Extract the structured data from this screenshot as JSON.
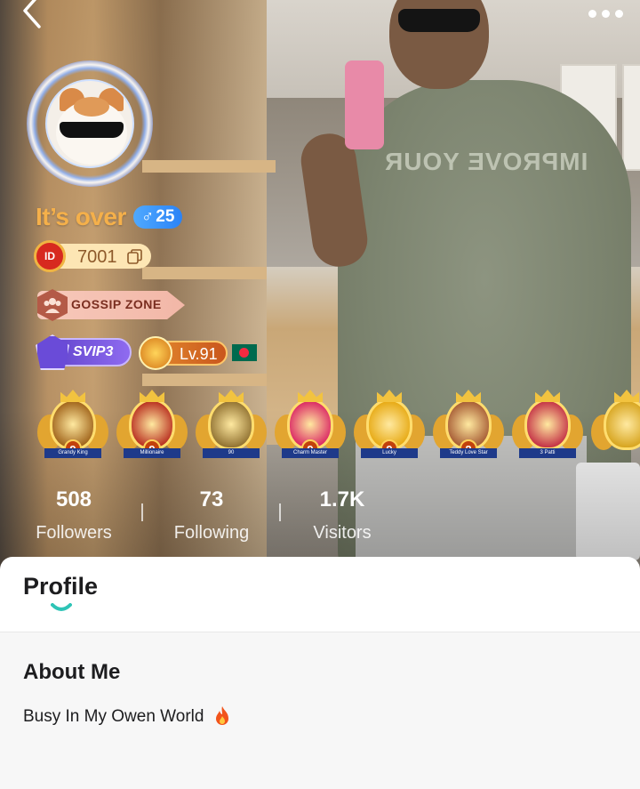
{
  "header": {
    "more_icon": "more-dots-icon",
    "back_icon": "chevron-left-icon"
  },
  "background_photo": {
    "shirt_text": "IMPROVE YOUR"
  },
  "user": {
    "name": "It’s over",
    "gender_symbol": "♂",
    "age": "25",
    "id_badge_text": "ID",
    "id_value": "7001",
    "zone_label": "GOSSIP ZONE",
    "svip_label": "SVIP3",
    "level_label": "Lv.91",
    "country_flag": "bangladesh-flag"
  },
  "colors": {
    "name": "#f5b04a",
    "gender_badge": "#2b83f6",
    "tab_indicator": "#2ec4b6"
  },
  "medals": [
    {
      "name": "Grandy King",
      "number": "9",
      "color": "#9a5b12"
    },
    {
      "name": "Millionaire",
      "number": "9",
      "color": "#b42318"
    },
    {
      "name": "90",
      "number": "",
      "color": "#8a6a2a"
    },
    {
      "name": "Charm Master",
      "number": "9",
      "color": "#d81b60"
    },
    {
      "name": "Lucky",
      "number": "9",
      "color": "#e5a50a"
    },
    {
      "name": "Teddy Love Star",
      "number": "2",
      "color": "#a0522d"
    },
    {
      "name": "3 Patti",
      "number": "",
      "color": "#c02640"
    },
    {
      "name": "",
      "number": "",
      "color": "#d4a017"
    }
  ],
  "stats": [
    {
      "value": "508",
      "label": "Followers"
    },
    {
      "value": "73",
      "label": "Following"
    },
    {
      "value": "1.7K",
      "label": "Visitors"
    }
  ],
  "tabs": {
    "active": "Profile"
  },
  "about": {
    "title": "About Me",
    "text": "Busy In My Owen World"
  }
}
